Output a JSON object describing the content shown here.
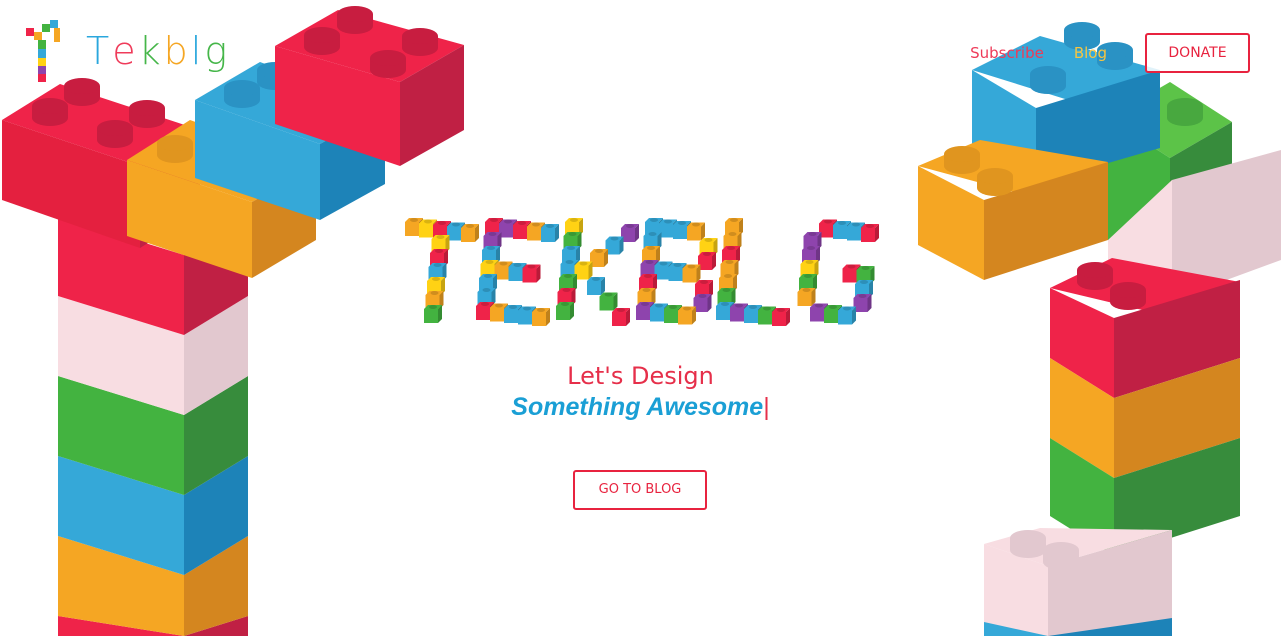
{
  "brand": {
    "name": "Tekblg",
    "letter_colors": [
      "#2aa7dd",
      "#ef3b5a",
      "#45b649",
      "#f5a623",
      "#2aa7dd",
      "#45b649"
    ]
  },
  "nav": {
    "subscribe": "Subscribe",
    "blog": "Blog",
    "donate": "DONATE"
  },
  "hero": {
    "logo_text": "TEKBLG",
    "tagline_line1": "Let's Design",
    "tagline_line2": "Something Awesome",
    "caret": "|",
    "cta": "GO TO BLOG"
  },
  "colors": {
    "accent": "#e8233f",
    "red": "#ef2349",
    "red_side": "#c02044",
    "blue": "#35a8d8",
    "blue_side": "#1d83b8",
    "green": "#43b340",
    "green_side": "#378c3c",
    "orange": "#f5a623",
    "orange_side": "#d4861f",
    "pink": "#f8dde2",
    "pink_side": "#e2c8cf",
    "yellow": "#ffd214",
    "purple": "#8e44ad"
  }
}
